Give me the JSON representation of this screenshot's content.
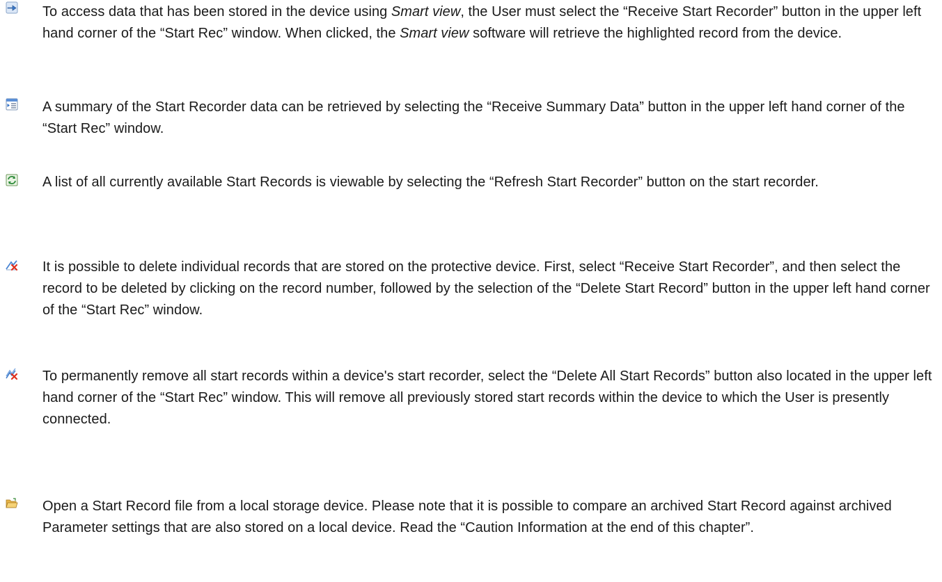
{
  "entries": [
    {
      "icon": "receive-start-recorder-icon",
      "parts": [
        "To access data that has been stored in the device using ",
        "Smart view",
        ", the User must select the “Receive Start Recorder” button in the upper left hand corner of the “Start Rec” window.  When clicked, the ",
        "Smart view",
        " software will retrieve the highlighted record from the device."
      ]
    },
    {
      "icon": "receive-summary-data-icon",
      "text": "A summary of the Start Recorder data can be retrieved by selecting the “Receive Summary Data” button in the upper left hand corner of the “Start Rec” window."
    },
    {
      "icon": "refresh-start-recorder-icon",
      "text": "A list of all currently available Start Records is viewable by selecting the “Refresh Start Recorder” button on the start recorder."
    },
    {
      "icon": "delete-start-record-icon",
      "text": "It is possible to delete individual records that are stored on the protective device.  First, select “Receive Start Recorder”, and then select the record to be deleted by clicking on the record number, followed by the selection of the “Delete Start Record” button  in the upper left hand corner of the “Start Rec” window."
    },
    {
      "icon": "delete-all-start-records-icon",
      "text": "To permanently remove all start records within a device's start recorder, select the “Delete All Start Records” button also located in the upper left hand corner of the “Start Rec” window.  This will remove all previously stored start records  within the device to which the User is presently connected."
    },
    {
      "icon": "open-folder-icon",
      "text": "Open a Start Record file from a local storage device. Please note that it is possible to compare an archived Start Record against archived Parameter settings that are also stored on a local device. Read the “Caution Information at the end of this chapter”."
    }
  ]
}
